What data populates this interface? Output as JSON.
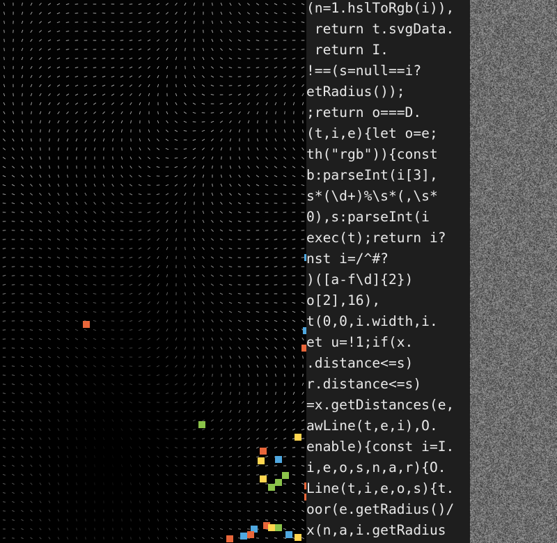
{
  "canvas": {
    "background": "#000000",
    "field_color": "#d8d8d8",
    "particle_colors": [
      "#e8663a",
      "#8bc34a",
      "#ffd54f",
      "#4fa8e0"
    ]
  },
  "code_panel": {
    "background": "#1e1e1e",
    "text_color": "#e8e8e8",
    "lines": [
      "(n=1.hslToRgb(i)),",
      " return t.svgData.",
      " return I.",
      "!==(s=null==i?",
      "etRadius());",
      ";return o===D.",
      "(t,i,e){let o=e;",
      "th(\"rgb\")){const",
      "b:parseInt(i[3],",
      "s*(\\d+)%\\s*(,\\s*",
      "0),s:parseInt(i",
      "exec(t);return i?",
      "nst i=/^#?",
      ")([a-f\\d]{2})",
      "o[2],16),",
      "t(0,0,i.width,i.",
      "et u=!1;if(x.",
      ".distance<=s)",
      "r.distance<=s)",
      "=x.getDistances(e,",
      "awLine(t,e,i),O.",
      "enable){const i=I.",
      "i,e,o,s,n,a,r){O.",
      "Line(t,i,e,o,s){t.",
      "oor(e.getRadius()/",
      "x(n,a,i.getRadius"
    ]
  },
  "noise_panel": {
    "base_color": "#6a6a6a"
  }
}
